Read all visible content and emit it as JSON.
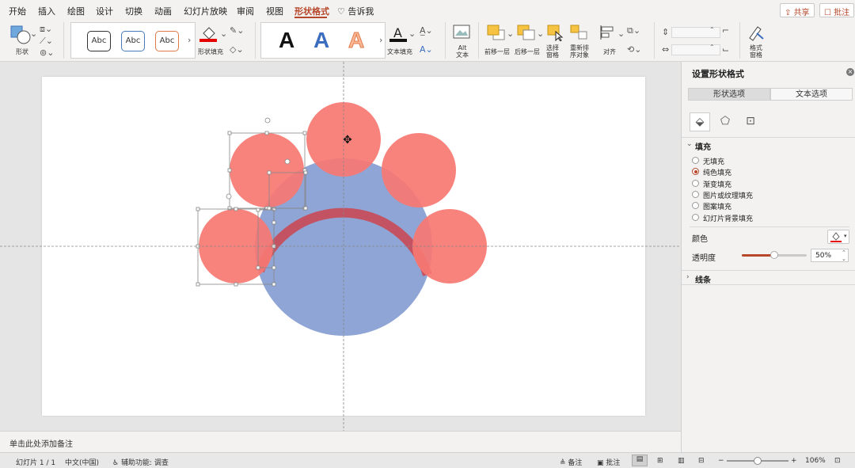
{
  "menu": {
    "tabs": [
      "开始",
      "插入",
      "绘图",
      "设计",
      "切换",
      "动画",
      "幻灯片放映",
      "审阅",
      "视图",
      "形状格式"
    ],
    "active_tab": "形状格式",
    "tell_me": "告诉我",
    "share_label": "共享",
    "comments_label": "批注"
  },
  "ribbon": {
    "shape_label": "形状",
    "style_samples": [
      "Abc",
      "Abc",
      "Abc"
    ],
    "shape_fill_label": "形状填充",
    "wordart_letters": [
      "A",
      "A",
      "A"
    ],
    "text_fill_label": "文本填充",
    "alt_text_label": "Alt\n文本",
    "bring_forward_label": "前移一层",
    "send_backward_label": "后移一层",
    "selection_pane_label": "选择\n窗格",
    "reorder_label": "重新排\n序对象",
    "align_label": "对齐",
    "format_pane_label": "格式\n窗格",
    "fill_color": "#e60000"
  },
  "slide": {
    "circles": [
      {
        "role": "big",
        "fill": "#8fa5d6"
      },
      {
        "role": "petal",
        "fill": "#f77872"
      }
    ],
    "arc_color": "#c94a55"
  },
  "notes": {
    "placeholder": "单击此处添加备注"
  },
  "pane": {
    "title": "设置形状格式",
    "tab_shape": "形状选项",
    "tab_text": "文本选项",
    "fill_section": "填充",
    "fill_options": [
      "无填充",
      "纯色填充",
      "渐变填充",
      "图片或纹理填充",
      "图案填充",
      "幻灯片背景填充"
    ],
    "fill_selected": "纯色填充",
    "color_label": "颜色",
    "transparency_label": "透明度",
    "transparency_value": "50%",
    "transparency": 0.5,
    "line_section": "线条",
    "color_swatch": "#e60000"
  },
  "status": {
    "slide_info": "幻灯片 1 / 1",
    "language": "中文(中国)",
    "accessibility": "辅助功能: 调查",
    "notes_label": "备注",
    "comments_label": "批注",
    "zoom": "106%",
    "zoom_level": 0.5
  }
}
